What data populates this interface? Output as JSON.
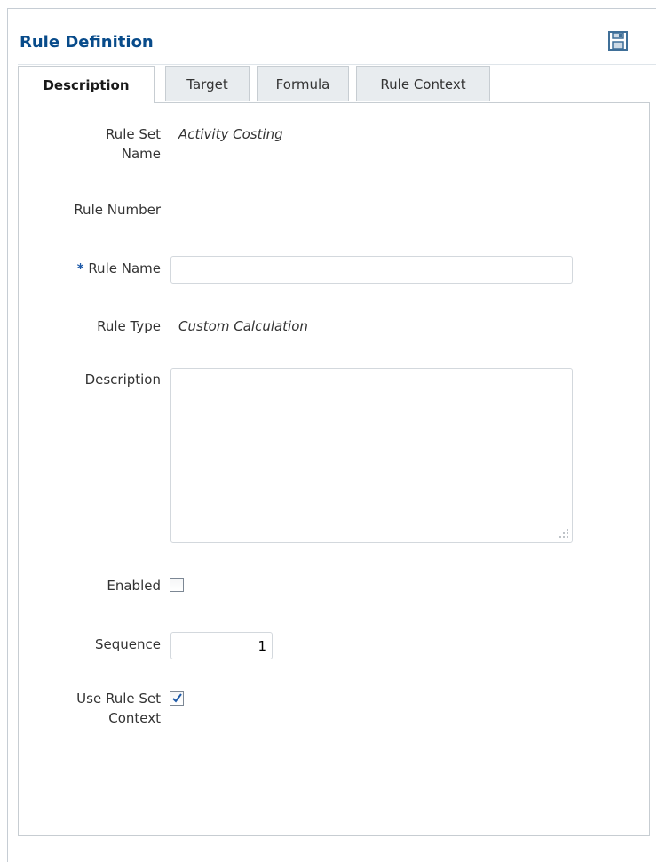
{
  "panel": {
    "title": "Rule Definition",
    "save_icon": "save-icon"
  },
  "tabs": [
    {
      "label": "Description",
      "active": true
    },
    {
      "label": "Target",
      "active": false
    },
    {
      "label": "Formula",
      "active": false
    },
    {
      "label": "Rule Context",
      "active": false
    }
  ],
  "form": {
    "rule_set_name": {
      "label_line1": "Rule Set",
      "label_line2": "Name",
      "value": "Activity Costing"
    },
    "rule_number": {
      "label": "Rule Number",
      "value": ""
    },
    "rule_name": {
      "required_marker": "*",
      "label": "Rule Name",
      "value": ""
    },
    "rule_type": {
      "label": "Rule Type",
      "value": "Custom Calculation"
    },
    "description": {
      "label": "Description",
      "value": ""
    },
    "enabled": {
      "label": "Enabled",
      "checked": false
    },
    "sequence": {
      "label": "Sequence",
      "value": "1"
    },
    "use_rule_set_context": {
      "label_line1": "Use Rule Set",
      "label_line2": "Context",
      "checked": true
    }
  },
  "colors": {
    "title": "#084b8a",
    "required": "#1e5aa8",
    "border": "#c7cdd2",
    "check": "#1e5aa8"
  }
}
